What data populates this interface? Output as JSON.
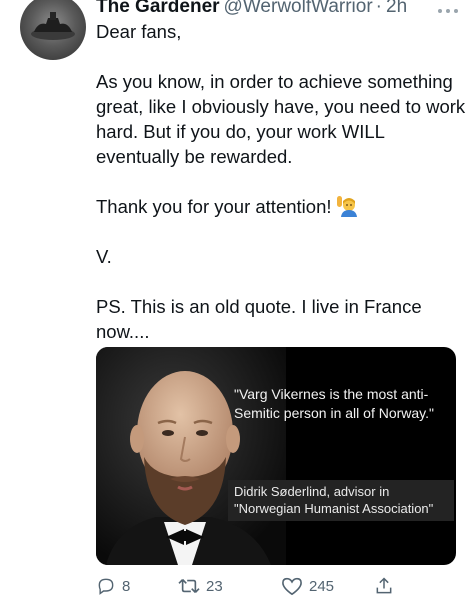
{
  "tweet": {
    "display_name": "The Gardener",
    "handle": "@WerwolfWarrior",
    "separator": "·",
    "time": "2h",
    "lines": {
      "greeting": "Dear fans,",
      "paragraph1": "As you know, in order to achieve something great, like I obviously have, you need to work hard. But if you do, your work WILL eventually be rewarded.",
      "thanks": "Thank you for your attention!",
      "signoff": "V.",
      "ps": "PS. This is an old quote. I live in France now...."
    },
    "emoji": "person-raising-hand",
    "media": {
      "quote": "\"Varg Vikernes is the most anti-Semitic person in all of Norway.\"",
      "attribution": "Didrik Søderlind, advisor in \"Norwegian Humanist Association\""
    },
    "actions": {
      "replies": "8",
      "retweets": "23",
      "likes": "245"
    }
  },
  "colors": {
    "text": "#0f1419",
    "muted": "#536471",
    "media_bg": "#000000",
    "caption_bg": "#232323"
  }
}
